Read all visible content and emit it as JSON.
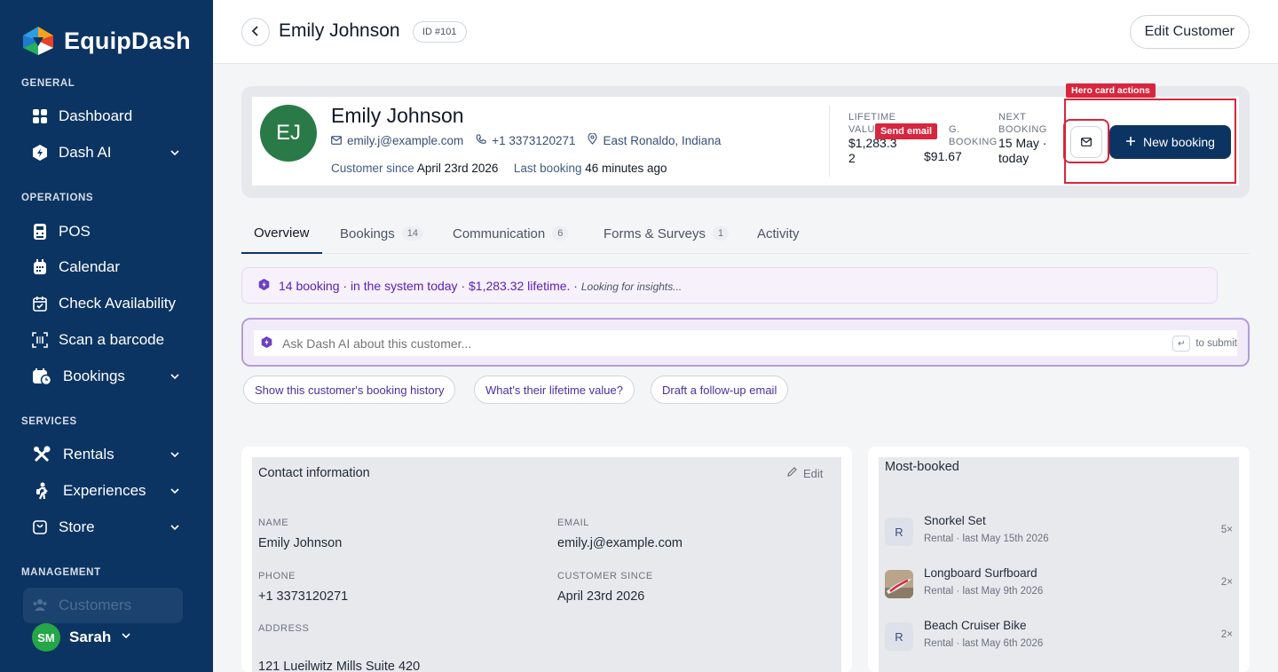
{
  "brand": {
    "name": "EquipDash"
  },
  "sidebar": {
    "sections": {
      "general": "GENERAL",
      "operations": "OPERATIONS",
      "services": "SERVICES",
      "management": "MANAGEMENT"
    },
    "items": {
      "dashboard": "Dashboard",
      "dash_ai": "Dash AI",
      "pos": "POS",
      "calendar": "Calendar",
      "check_availability": "Check Availability",
      "scan_barcode": "Scan a barcode",
      "bookings": "Bookings",
      "rentals": "Rentals",
      "experiences": "Experiences",
      "store": "Store",
      "customers": "Customers"
    },
    "user": {
      "initials": "SM",
      "name": "Sarah"
    }
  },
  "header": {
    "title": "Emily Johnson",
    "id_badge": "ID #101",
    "edit_label": "Edit Customer"
  },
  "hero": {
    "initials": "EJ",
    "name": "Emily Johnson",
    "email": "emily.j@example.com",
    "phone": "+1 3373120271",
    "location": "East Ronaldo, Indiana",
    "since_label": "Customer since",
    "since_value": "April 23rd 2026",
    "last_booking_label": "Last booking",
    "last_booking_value": "46 minutes ago",
    "stats": {
      "lifetime_label_1": "LIFETIME",
      "lifetime_label_2": "VALU",
      "lifetime_value_1": "$1,283.3",
      "lifetime_value_2": "2",
      "avg_label_1": "G.",
      "avg_label_2": "BOOKING",
      "avg_value": "$91.67",
      "next_label_1": "NEXT",
      "next_label_2": "BOOKING",
      "next_value_1": "15 May ·",
      "next_value_2": "today"
    },
    "send_email_tag": "Send email",
    "actions_tag": "Hero card actions",
    "new_booking_label": "New booking"
  },
  "tabs": [
    {
      "label": "Overview",
      "count": ""
    },
    {
      "label": "Bookings",
      "count": "14"
    },
    {
      "label": "Communication",
      "count": "6"
    },
    {
      "label": "Forms & Surveys",
      "count": "1"
    },
    {
      "label": "Activity",
      "count": ""
    }
  ],
  "insight": {
    "text": "14 booking · in the system today · $1,283.32 lifetime. ·",
    "status": "Looking for insights..."
  },
  "ask": {
    "placeholder": "Ask Dash AI about this customer...",
    "submit_hint": "to submit",
    "kbd": "↵"
  },
  "suggestions": [
    "Show this customer's booking history",
    "What's their lifetime value?",
    "Draft a follow-up email"
  ],
  "contact": {
    "title": "Contact information",
    "edit": "Edit",
    "name_label": "NAME",
    "name_value": "Emily Johnson",
    "email_label": "EMAIL",
    "email_value": "emily.j@example.com",
    "phone_label": "PHONE",
    "phone_value": "+1 3373120271",
    "since_label": "CUSTOMER SINCE",
    "since_value": "April 23rd 2026",
    "address_label": "ADDRESS",
    "address_value": "121 Lueilwitz Mills Suite 420"
  },
  "most_booked": {
    "title": "Most-booked",
    "items": [
      {
        "thumb": "R",
        "name": "Snorkel Set",
        "sub": "Rental · last May 15th 2026",
        "count": "5×"
      },
      {
        "thumb": "",
        "name": "Longboard Surfboard",
        "sub": "Rental · last May 9th 2026",
        "count": "2×"
      },
      {
        "thumb": "R",
        "name": "Beach Cruiser Bike",
        "sub": "Rental · last May 6th 2026",
        "count": "2×"
      }
    ]
  },
  "colors": {
    "sidebar_bg": "#0c3462",
    "primary": "#0c3462",
    "avatar_green": "#2a7a48",
    "annotation_red": "#d7263d",
    "ai_purple": "#5b21b6"
  }
}
